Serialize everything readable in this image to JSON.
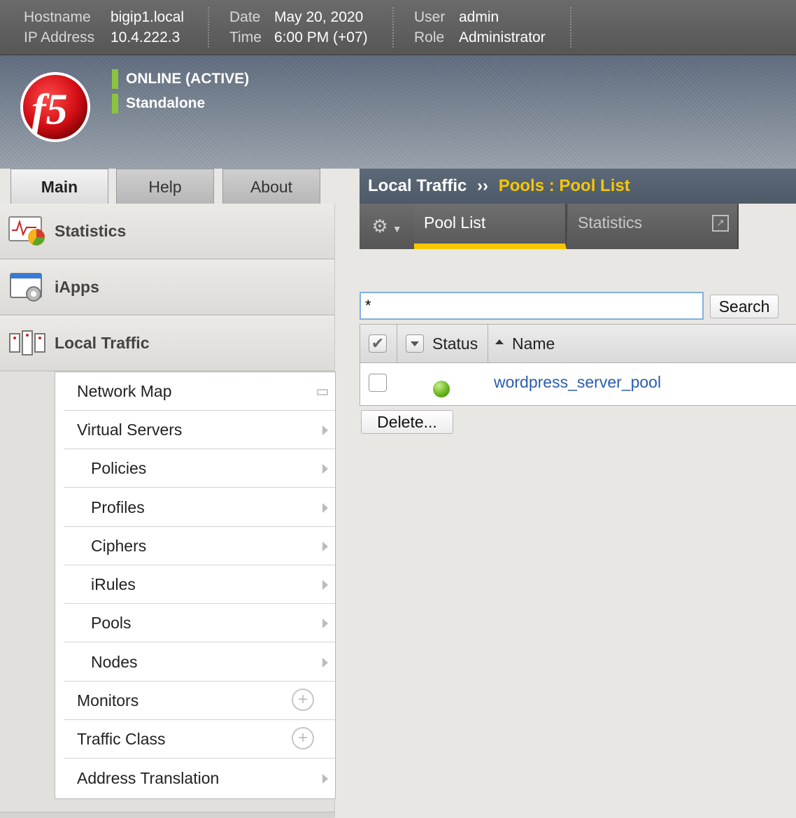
{
  "topbar": {
    "hostname_label": "Hostname",
    "hostname": "bigip1.local",
    "ip_label": "IP Address",
    "ip": "10.4.222.3",
    "date_label": "Date",
    "date": "May 20, 2020",
    "time_label": "Time",
    "time": "6:00 PM (+07)",
    "user_label": "User",
    "user": "admin",
    "role_label": "Role",
    "role": "Administrator"
  },
  "banner": {
    "status_online": "ONLINE (ACTIVE)",
    "status_mode": "Standalone",
    "status_color": "#8bc540"
  },
  "tabs": [
    {
      "label": "Main",
      "active": true
    },
    {
      "label": "Help",
      "active": false
    },
    {
      "label": "About",
      "active": false
    }
  ],
  "leftnav": {
    "sections": [
      {
        "label": "Statistics",
        "icon": "statistics-icon"
      },
      {
        "label": "iApps",
        "icon": "iapps-icon"
      },
      {
        "label": "Local Traffic",
        "icon": "local-traffic-icon"
      }
    ],
    "items": [
      {
        "label": "Network Map",
        "indent": false,
        "marker": "map"
      },
      {
        "label": "Virtual Servers",
        "indent": false,
        "marker": "arrow"
      },
      {
        "label": "Policies",
        "indent": true,
        "marker": "arrow"
      },
      {
        "label": "Profiles",
        "indent": true,
        "marker": "arrow"
      },
      {
        "label": "Ciphers",
        "indent": true,
        "marker": "arrow"
      },
      {
        "label": "iRules",
        "indent": true,
        "marker": "arrow"
      },
      {
        "label": "Pools",
        "indent": true,
        "marker": "arrow",
        "selected": true
      },
      {
        "label": "Nodes",
        "indent": true,
        "marker": "arrow"
      },
      {
        "label": "Monitors",
        "indent": false,
        "marker": "plus"
      },
      {
        "label": "Traffic Class",
        "indent": false,
        "marker": "plus"
      },
      {
        "label": "Address Translation",
        "indent": false,
        "marker": "arrow"
      }
    ]
  },
  "breadcrumb": {
    "root": "Local Traffic",
    "separator": "››",
    "current": "Pools : Pool List",
    "accent_color": "#f7c600"
  },
  "subtabs": {
    "gear_icon": "gear-icon",
    "pool_list": "Pool List",
    "statistics": "Statistics"
  },
  "search": {
    "value": "*",
    "button": "Search"
  },
  "table": {
    "columns": [
      "Status",
      "Name"
    ],
    "rows": [
      {
        "status": "available",
        "status_color": "#63b21b",
        "name": "wordpress_server_pool"
      }
    ]
  },
  "actions": {
    "delete": "Delete..."
  }
}
